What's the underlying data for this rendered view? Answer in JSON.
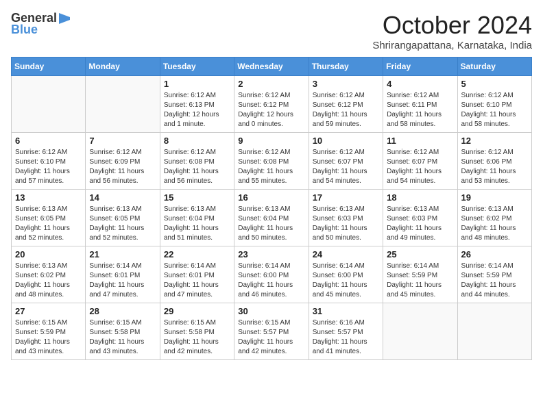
{
  "logo": {
    "general": "General",
    "blue": "Blue"
  },
  "title": "October 2024",
  "location": "Shrirangapattana, Karnataka, India",
  "days_of_week": [
    "Sunday",
    "Monday",
    "Tuesday",
    "Wednesday",
    "Thursday",
    "Friday",
    "Saturday"
  ],
  "weeks": [
    [
      {
        "day": "",
        "info": ""
      },
      {
        "day": "",
        "info": ""
      },
      {
        "day": "1",
        "info": "Sunrise: 6:12 AM\nSunset: 6:13 PM\nDaylight: 12 hours and 1 minute."
      },
      {
        "day": "2",
        "info": "Sunrise: 6:12 AM\nSunset: 6:12 PM\nDaylight: 12 hours and 0 minutes."
      },
      {
        "day": "3",
        "info": "Sunrise: 6:12 AM\nSunset: 6:12 PM\nDaylight: 11 hours and 59 minutes."
      },
      {
        "day": "4",
        "info": "Sunrise: 6:12 AM\nSunset: 6:11 PM\nDaylight: 11 hours and 58 minutes."
      },
      {
        "day": "5",
        "info": "Sunrise: 6:12 AM\nSunset: 6:10 PM\nDaylight: 11 hours and 58 minutes."
      }
    ],
    [
      {
        "day": "6",
        "info": "Sunrise: 6:12 AM\nSunset: 6:10 PM\nDaylight: 11 hours and 57 minutes."
      },
      {
        "day": "7",
        "info": "Sunrise: 6:12 AM\nSunset: 6:09 PM\nDaylight: 11 hours and 56 minutes."
      },
      {
        "day": "8",
        "info": "Sunrise: 6:12 AM\nSunset: 6:08 PM\nDaylight: 11 hours and 56 minutes."
      },
      {
        "day": "9",
        "info": "Sunrise: 6:12 AM\nSunset: 6:08 PM\nDaylight: 11 hours and 55 minutes."
      },
      {
        "day": "10",
        "info": "Sunrise: 6:12 AM\nSunset: 6:07 PM\nDaylight: 11 hours and 54 minutes."
      },
      {
        "day": "11",
        "info": "Sunrise: 6:12 AM\nSunset: 6:07 PM\nDaylight: 11 hours and 54 minutes."
      },
      {
        "day": "12",
        "info": "Sunrise: 6:12 AM\nSunset: 6:06 PM\nDaylight: 11 hours and 53 minutes."
      }
    ],
    [
      {
        "day": "13",
        "info": "Sunrise: 6:13 AM\nSunset: 6:05 PM\nDaylight: 11 hours and 52 minutes."
      },
      {
        "day": "14",
        "info": "Sunrise: 6:13 AM\nSunset: 6:05 PM\nDaylight: 11 hours and 52 minutes."
      },
      {
        "day": "15",
        "info": "Sunrise: 6:13 AM\nSunset: 6:04 PM\nDaylight: 11 hours and 51 minutes."
      },
      {
        "day": "16",
        "info": "Sunrise: 6:13 AM\nSunset: 6:04 PM\nDaylight: 11 hours and 50 minutes."
      },
      {
        "day": "17",
        "info": "Sunrise: 6:13 AM\nSunset: 6:03 PM\nDaylight: 11 hours and 50 minutes."
      },
      {
        "day": "18",
        "info": "Sunrise: 6:13 AM\nSunset: 6:03 PM\nDaylight: 11 hours and 49 minutes."
      },
      {
        "day": "19",
        "info": "Sunrise: 6:13 AM\nSunset: 6:02 PM\nDaylight: 11 hours and 48 minutes."
      }
    ],
    [
      {
        "day": "20",
        "info": "Sunrise: 6:13 AM\nSunset: 6:02 PM\nDaylight: 11 hours and 48 minutes."
      },
      {
        "day": "21",
        "info": "Sunrise: 6:14 AM\nSunset: 6:01 PM\nDaylight: 11 hours and 47 minutes."
      },
      {
        "day": "22",
        "info": "Sunrise: 6:14 AM\nSunset: 6:01 PM\nDaylight: 11 hours and 47 minutes."
      },
      {
        "day": "23",
        "info": "Sunrise: 6:14 AM\nSunset: 6:00 PM\nDaylight: 11 hours and 46 minutes."
      },
      {
        "day": "24",
        "info": "Sunrise: 6:14 AM\nSunset: 6:00 PM\nDaylight: 11 hours and 45 minutes."
      },
      {
        "day": "25",
        "info": "Sunrise: 6:14 AM\nSunset: 5:59 PM\nDaylight: 11 hours and 45 minutes."
      },
      {
        "day": "26",
        "info": "Sunrise: 6:14 AM\nSunset: 5:59 PM\nDaylight: 11 hours and 44 minutes."
      }
    ],
    [
      {
        "day": "27",
        "info": "Sunrise: 6:15 AM\nSunset: 5:59 PM\nDaylight: 11 hours and 43 minutes."
      },
      {
        "day": "28",
        "info": "Sunrise: 6:15 AM\nSunset: 5:58 PM\nDaylight: 11 hours and 43 minutes."
      },
      {
        "day": "29",
        "info": "Sunrise: 6:15 AM\nSunset: 5:58 PM\nDaylight: 11 hours and 42 minutes."
      },
      {
        "day": "30",
        "info": "Sunrise: 6:15 AM\nSunset: 5:57 PM\nDaylight: 11 hours and 42 minutes."
      },
      {
        "day": "31",
        "info": "Sunrise: 6:16 AM\nSunset: 5:57 PM\nDaylight: 11 hours and 41 minutes."
      },
      {
        "day": "",
        "info": ""
      },
      {
        "day": "",
        "info": ""
      }
    ]
  ]
}
